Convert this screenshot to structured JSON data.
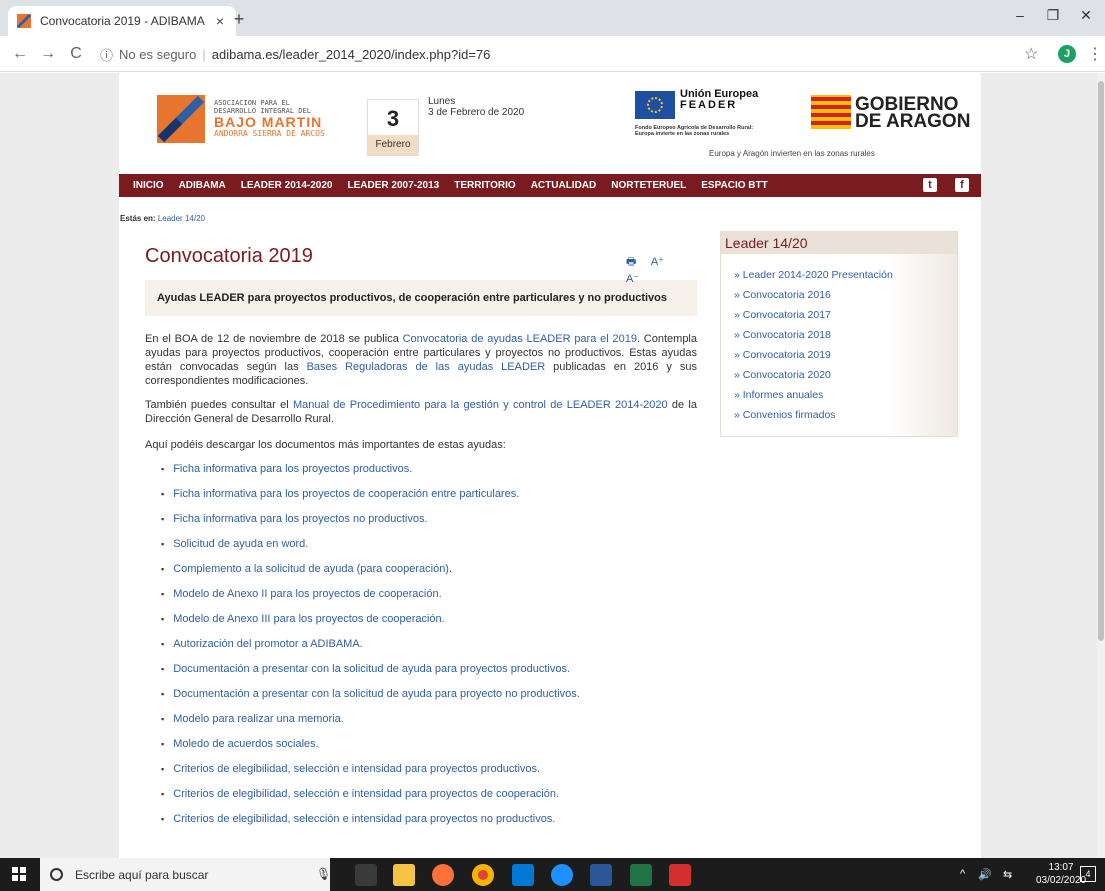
{
  "browser": {
    "tab_title": "Convocatoria 2019 - ADIBAMA",
    "tab_close": "×",
    "new_tab": "+",
    "back": "←",
    "forward": "→",
    "reload": "C",
    "security_icon": "ⓘ",
    "security_text": "No es seguro",
    "url": "adibama.es/leader_2014_2020/index.php?id=76",
    "bookmark": "☆",
    "profile_initial": "J",
    "menu": "⋮",
    "minimize": "–",
    "maximize": "❐",
    "close": "✕"
  },
  "header": {
    "logo_line1": "ASOCIACION PARA EL",
    "logo_line1b": "DESARROLLO INTEGRAL DEL",
    "logo_line2": "BAJO MARTIN",
    "logo_line3": "ANDORRA SIERRA DE ARCOS",
    "date_day": "3",
    "date_month": "Febrero",
    "date_weekday": "Lunes",
    "date_full": "3 de Febrero de 2020",
    "eu_line1": "Unión Europea",
    "eu_line2": "FEADER",
    "eu_line3": "Fondo Europeo Agrícola de Desarrollo Rural:",
    "eu_line4": "Europa invierte en las zonas rurales",
    "aragon_line1": "GOBIERNO",
    "aragon_line2": "DE ARAGON",
    "caption": "Europa y Aragón invierten en las zonas rurales"
  },
  "nav": {
    "items": [
      "INICIO",
      "ADIBAMA",
      "LEADER 2014-2020",
      "LEADER 2007-2013",
      "TERRITORIO",
      "ACTUALIDAD",
      "NORTETERUEL",
      "ESPACIO BTT"
    ],
    "twitter": "t",
    "facebook": "f"
  },
  "breadcrumb": {
    "label": "Estás en:",
    "link": "Leader 14/20"
  },
  "content": {
    "title": "Convocatoria 2019",
    "tool_print": "🖶",
    "tool_font_up": "A⁺",
    "tool_font_down": "A⁻",
    "lead": "Ayudas LEADER para proyectos productivos, de cooperación entre particulares y no productivos",
    "p1_a": "En el BOA de 12 de noviembre de 2018 se publica ",
    "p1_link1": "Convocatoria de ayudas LEADER para el 2019",
    "p1_b": ". Contempla ayudas para proyectos productivos, cooperación entre particulares y proyectos no productivos. Estas ayudas están convocadas según las ",
    "p1_link2": "Bases Reguladoras de las ayudas LEADER",
    "p1_c": " publicadas en 2016 y sus correspondientes modificaciones.",
    "p2_a": "También puedes consultar el ",
    "p2_link": "Manual de Procedimiento para la gestión y control de LEADER 2014-2020",
    "p2_b": " de la Dirección General de Desarrollo Rural.",
    "p3": "Aquí podéis descargar los documentos más importantes de estas ayudas:",
    "docs": [
      "Ficha informativa para los proyectos productivos.",
      "Ficha informativa para los proyectos de cooperación entre particulares.",
      "Ficha informativa para los proyectos no productivos.",
      "Solicitud de ayuda en word.",
      "Complemento a la solicitud de ayuda (para cooperación).",
      "Modelo de Anexo II para los proyectos de cooperación.",
      "Modelo de Anexo III para los proyectos de cooperación.",
      "Autorización del promotor a ADIBAMA.",
      "Documentación a presentar con la solicitud de ayuda para proyectos productivos.",
      "Documentación a presentar con la solicitud de ayuda para proyecto no productivos.",
      "Modelo para realizar una memoria.",
      "Moledo de acuerdos sociales.",
      "Criterios de elegibilidad, selección e intensidad para proyectos productivos.",
      "Criterios de elegibilidad, selección e intensidad para proyectos de cooperación.",
      "Criterios de elegibilidad, selección e intensidad para proyectos no productivos."
    ]
  },
  "sidebar": {
    "title": "Leader 14/20",
    "items": [
      "» Leader 2014-2020 Presentación",
      "» Convocatoria 2016",
      "» Convocatoria 2017",
      "» Convocatoria 2018",
      "» Convocatoria 2019",
      "» Convocatoria 2020",
      "» Informes anuales",
      "» Convenios firmados"
    ]
  },
  "taskbar": {
    "search_placeholder": "Escribe aquí para buscar",
    "mic": "🎙",
    "tray_up": "^",
    "tray_volume": "🔊",
    "tray_network": "⇆",
    "time": "13:07",
    "date": "03/02/2020",
    "notifications": "4"
  },
  "colors": {
    "brand": "#7a1c1f",
    "link": "#2f5fa4",
    "accent_orange": "#e8752d"
  }
}
